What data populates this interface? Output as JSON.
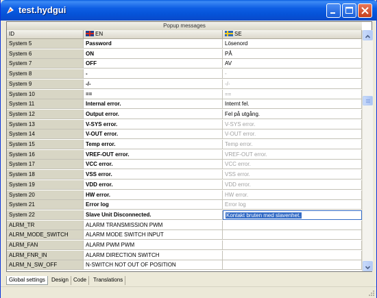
{
  "window": {
    "title": "test.hydgui"
  },
  "panel": {
    "title": "Popup messages"
  },
  "columns": {
    "id": "ID",
    "en": "EN",
    "se": "SE"
  },
  "rows": [
    {
      "id": "System 5",
      "en": "Password",
      "se": "Lösenord",
      "en_bold": true,
      "se_gray": false
    },
    {
      "id": "System 6",
      "en": "ON",
      "se": "PÅ",
      "en_bold": true,
      "se_gray": false
    },
    {
      "id": "System 7",
      "en": "OFF",
      "se": "AV",
      "en_bold": true,
      "se_gray": false
    },
    {
      "id": "System 8",
      "en": "-",
      "se": "-",
      "en_bold": true,
      "se_gray": true
    },
    {
      "id": "System 9",
      "en": "-/-",
      "se": "-/-",
      "en_bold": true,
      "se_gray": true
    },
    {
      "id": "System 10",
      "en": "==",
      "se": "==",
      "en_bold": true,
      "se_gray": true
    },
    {
      "id": "System 11",
      "en": "Internal error.",
      "se": "Internt fel.",
      "en_bold": true,
      "se_gray": false
    },
    {
      "id": "System 12",
      "en": "Output error.",
      "se": "Fel på utgång.",
      "en_bold": true,
      "se_gray": false
    },
    {
      "id": "System 13",
      "en": "V-SYS error.",
      "se": "V-SYS error.",
      "en_bold": true,
      "se_gray": true
    },
    {
      "id": "System 14",
      "en": "V-OUT error.",
      "se": "V-OUT error.",
      "en_bold": true,
      "se_gray": true
    },
    {
      "id": "System 15",
      "en": "Temp error.",
      "se": "Temp error.",
      "en_bold": true,
      "se_gray": true
    },
    {
      "id": "System 16",
      "en": "VREF-OUT error.",
      "se": "VREF-OUT error.",
      "en_bold": true,
      "se_gray": true
    },
    {
      "id": "System 17",
      "en": "VCC error.",
      "se": "VCC error.",
      "en_bold": true,
      "se_gray": true
    },
    {
      "id": "System 18",
      "en": "VSS error.",
      "se": "VSS error.",
      "en_bold": true,
      "se_gray": true
    },
    {
      "id": "System 19",
      "en": "VDD error.",
      "se": "VDD error.",
      "en_bold": true,
      "se_gray": true
    },
    {
      "id": "System 20",
      "en": "HW error.",
      "se": "HW error.",
      "en_bold": true,
      "se_gray": true
    },
    {
      "id": "System 21",
      "en": "Error log",
      "se": "Error log",
      "en_bold": true,
      "se_gray": true
    },
    {
      "id": "System 22",
      "en": "Slave Unit Disconnected.",
      "se": "Kontakt bruten med slavenhet.",
      "en_bold": true,
      "se_gray": false,
      "editing": true
    },
    {
      "id": "ALRM_TR",
      "en": "ALARM TRANSMISSION PWM",
      "se": "",
      "en_bold": false,
      "se_gray": false
    },
    {
      "id": "ALRM_MODE_SWITCH",
      "en": "ALARM MODE SWITCH INPUT",
      "se": "",
      "en_bold": false,
      "se_gray": false
    },
    {
      "id": "ALRM_FAN",
      "en": "ALARM PWM PWM",
      "se": "",
      "en_bold": false,
      "se_gray": false
    },
    {
      "id": "ALRM_FNR_IN",
      "en": "ALARM DIRECTION SWITCH",
      "se": "",
      "en_bold": false,
      "se_gray": false
    },
    {
      "id": "ALRM_N_SW_OFF",
      "en": "N-SWITCH NOT OUT OF POSITION",
      "se": "",
      "en_bold": false,
      "se_gray": false
    }
  ],
  "tabs": [
    "Global settings",
    "Design",
    "Code",
    "Translations"
  ],
  "active_tab": 0
}
